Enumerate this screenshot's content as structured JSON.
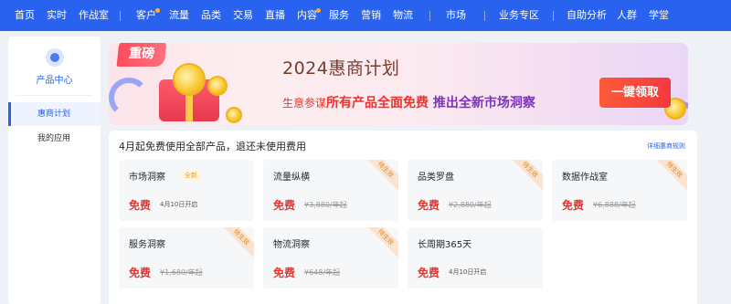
{
  "nav": {
    "items": [
      {
        "label": "首页"
      },
      {
        "label": "实时"
      },
      {
        "label": "作战室"
      },
      {
        "label": "客户"
      },
      {
        "label": "流量"
      },
      {
        "label": "品类"
      },
      {
        "label": "交易"
      },
      {
        "label": "直播"
      },
      {
        "label": "内容"
      },
      {
        "label": "服务"
      },
      {
        "label": "营销"
      },
      {
        "label": "物流"
      },
      {
        "label": "市场"
      },
      {
        "label": "业务专区"
      },
      {
        "label": "自助分析"
      },
      {
        "label": "人群"
      },
      {
        "label": "学堂"
      }
    ],
    "bg_color": "#2a62f0",
    "dot_color": "#ffb020"
  },
  "sidebar": {
    "title": "产品中心",
    "items": [
      {
        "label": "惠商计划",
        "active": true
      },
      {
        "label": "我的应用",
        "active": false
      }
    ]
  },
  "banner": {
    "tag": "重磅",
    "title": "2024惠商计划",
    "sub_part1": "生意参谋",
    "sub_part2": "所有产品全面免费",
    "sub_part3": "推出全新市场洞察",
    "button": "一键领取"
  },
  "products": {
    "header": "4月起免费使用全部产品，退还未使用费用",
    "link": "详细惠商规则",
    "cards": [
      {
        "name": "市场洞察",
        "badge": "全新",
        "free": "免费",
        "note": "4月10日开启",
        "original_price": "",
        "corner": ""
      },
      {
        "name": "流量纵横",
        "badge": "",
        "free": "免费",
        "note": "",
        "original_price": "¥3,880/年起",
        "corner": "待生效"
      },
      {
        "name": "品类罗盘",
        "badge": "",
        "free": "免费",
        "note": "",
        "original_price": "¥2,880/年起",
        "corner": "待生效"
      },
      {
        "name": "数据作战室",
        "badge": "",
        "free": "免费",
        "note": "",
        "original_price": "¥6,888/年起",
        "corner": "待生效"
      },
      {
        "name": "服务洞察",
        "badge": "",
        "free": "免费",
        "note": "",
        "original_price": "¥1,680/年起",
        "corner": "待生效"
      },
      {
        "name": "物流洞察",
        "badge": "",
        "free": "免费",
        "note": "",
        "original_price": "¥648/年起",
        "corner": "待生效"
      },
      {
        "name": "长周期365天",
        "badge": "",
        "free": "免费",
        "note": "4月10日开启",
        "original_price": "",
        "corner": ""
      }
    ]
  }
}
